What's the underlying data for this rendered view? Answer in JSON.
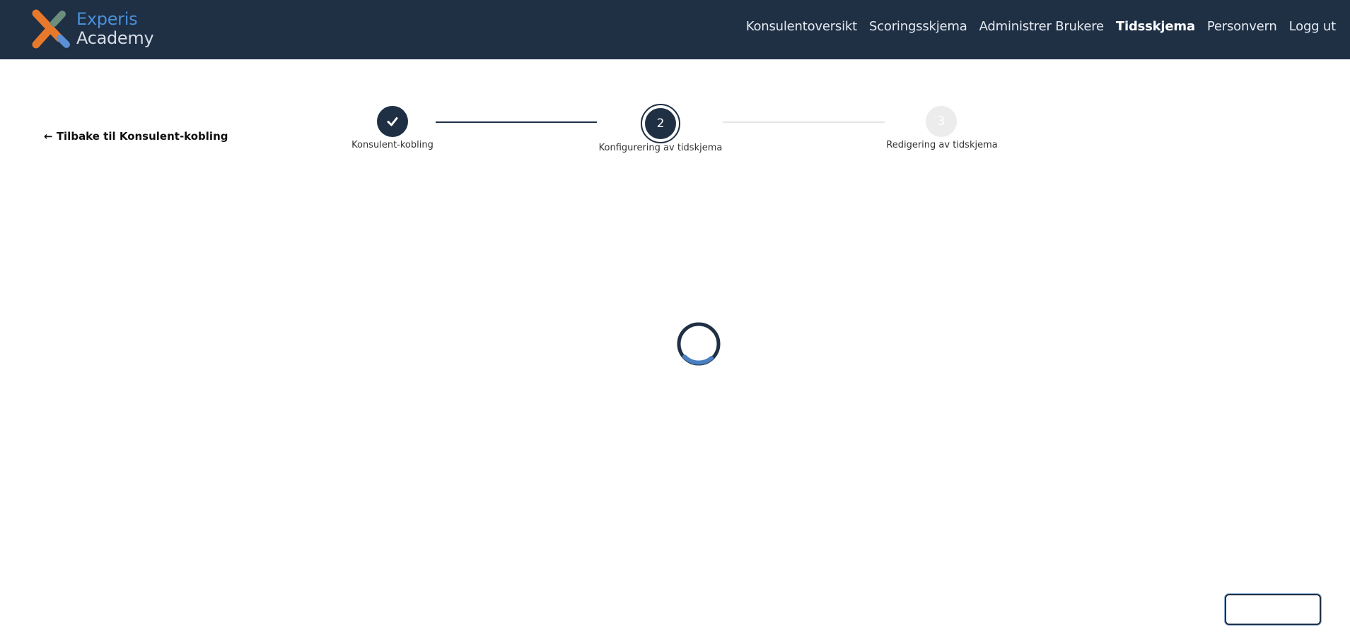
{
  "header": {
    "logo": {
      "line1": "Experis",
      "line2": "Academy",
      "colors": {
        "orange": "#e8792b",
        "green": "#6b8f7a",
        "blue": "#5b8fd6"
      }
    },
    "nav": [
      {
        "label": "Konsulentoversikt",
        "active": false
      },
      {
        "label": "Scoringsskjema",
        "active": false
      },
      {
        "label": "Administrer Brukere",
        "active": false
      },
      {
        "label": "Tidsskjema",
        "active": true
      },
      {
        "label": "Personvern",
        "active": false
      },
      {
        "label": "Logg ut",
        "active": false
      }
    ],
    "background": "#1f2f44"
  },
  "back_link": {
    "arrow": "←",
    "label": "Tilbake til Konsulent-kobling"
  },
  "stepper": {
    "steps": [
      {
        "number": "1",
        "label": "Konsulent-kobling",
        "status": "completed",
        "icon": "check-icon"
      },
      {
        "number": "2",
        "label": "Konfigurering av tidskjema",
        "status": "active"
      },
      {
        "number": "3",
        "label": "Redigering av tidskjema",
        "status": "upcoming"
      }
    ],
    "colors": {
      "active": "#1f2f44",
      "inactive": "#ececec"
    }
  },
  "loading": {
    "icon": "loading-spinner-icon",
    "colors": {
      "track": "#1f2f44",
      "arc": "#4a7fc1"
    }
  },
  "bottom_button": {
    "label": ""
  }
}
